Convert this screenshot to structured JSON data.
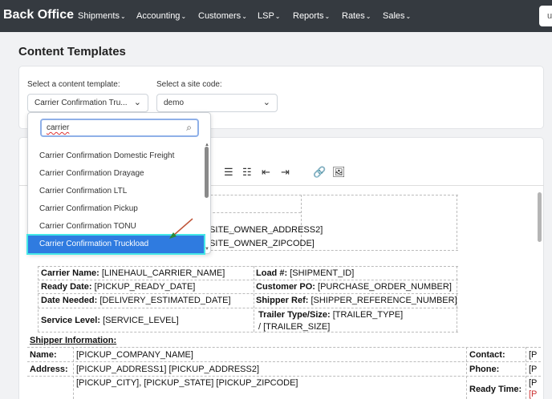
{
  "navbar": {
    "brand": "Back Office",
    "items": [
      "Shipments",
      "Accounting",
      "Customers",
      "LSP",
      "Reports",
      "Rates",
      "Sales"
    ],
    "user": "u"
  },
  "page": {
    "title": "Content Templates"
  },
  "selectors": {
    "template_label": "Select a content template:",
    "template_value": "Carrier Confirmation Tru...",
    "site_label": "Select a site code:",
    "site_value": "demo"
  },
  "dropdown": {
    "search_value": "carrier",
    "options": [
      "Carrier Confirmation Domestic Freight",
      "Carrier Confirmation Drayage",
      "Carrier Confirmation LTL",
      "Carrier Confirmation Pickup",
      "Carrier Confirmation TONU",
      "Carrier Confirmation Truckload"
    ],
    "selected": "Carrier Confirmation Truckload"
  },
  "doc": {
    "addr2": "[SITE_OWNER_ADDRESS2]",
    "zip": "[SITE_OWNER_ZIPCODE]",
    "rows": [
      {
        "l_label": "Carrier Name:",
        "l_value": "[LINEHAUL_CARRIER_NAME]",
        "r_label": "Load #:",
        "r_value": "[SHIPMENT_ID]"
      },
      {
        "l_label": "Ready Date:",
        "l_value": "[PICKUP_READY_DATE]",
        "r_label": "Customer PO:",
        "r_value": "[PURCHASE_ORDER_NUMBER]"
      },
      {
        "l_label": "Date Needed:",
        "l_value": "[DELIVERY_ESTIMATED_DATE]",
        "r_label": "Shipper Ref:",
        "r_value": "[SHIPPER_REFERENCE_NUMBER]"
      },
      {
        "l_label": "Service Level:",
        "l_value": "[SERVICE_LEVEL]",
        "r_label": "Trailer Type/Size:",
        "r_value": "[TRAILER_TYPE]",
        "r_value2": "/ [TRAILER_SIZE]"
      }
    ],
    "shipper_heading": "Shipper Information:",
    "shipper": {
      "name_label": "Name:",
      "name_value": "[PICKUP_COMPANY_NAME]",
      "address_label": "Address:",
      "address_value": "[PICKUP_ADDRESS1] [PICKUP_ADDRESS2]",
      "city_value": "[PICKUP_CITY], [PICKUP_STATE] [PICKUP_ZIPCODE]",
      "contact_label": "Contact:",
      "phone_label": "Phone:",
      "ready_label": "Ready Time:",
      "right_vals": [
        "[P",
        "[P",
        "[P",
        "[P"
      ]
    }
  }
}
